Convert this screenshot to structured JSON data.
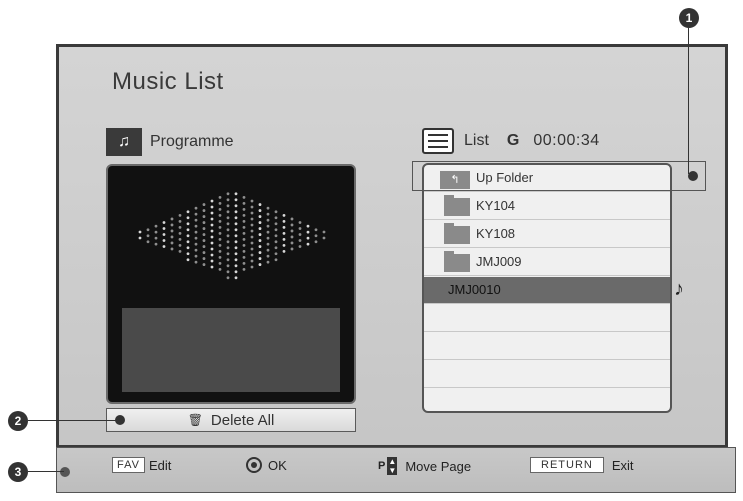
{
  "title": "Music List",
  "programme": {
    "label": "Programme"
  },
  "delete_all": {
    "label": "Delete All"
  },
  "list": {
    "label": "List",
    "channel": "G",
    "time": "00:00:34",
    "items": [
      {
        "name": "Up Folder",
        "type": "up"
      },
      {
        "name": "KY104",
        "type": "folder"
      },
      {
        "name": "KY108",
        "type": "folder"
      },
      {
        "name": "JMJ009",
        "type": "folder"
      },
      {
        "name": "JMJ0010",
        "type": "file",
        "selected": true
      }
    ]
  },
  "help": {
    "fav_key": "FAV",
    "fav_action": "Edit",
    "ok_action": "OK",
    "page_key": "P",
    "page_action": "Move Page",
    "return_key": "RETURN",
    "return_action": "Exit"
  },
  "callouts": [
    "1",
    "2",
    "3"
  ],
  "icons": {
    "programme": "music-note-icon",
    "list": "list-icon",
    "folder": "folder-icon",
    "up_folder": "up-folder-icon",
    "trash": "trash-icon",
    "ok": "ok-button-icon",
    "page": "page-updown-icon",
    "playing": "music-note-icon"
  },
  "colors": {
    "selected_row": "#6a6a6a",
    "panel_dark": "#111111",
    "frame": "#3a3a3a"
  }
}
